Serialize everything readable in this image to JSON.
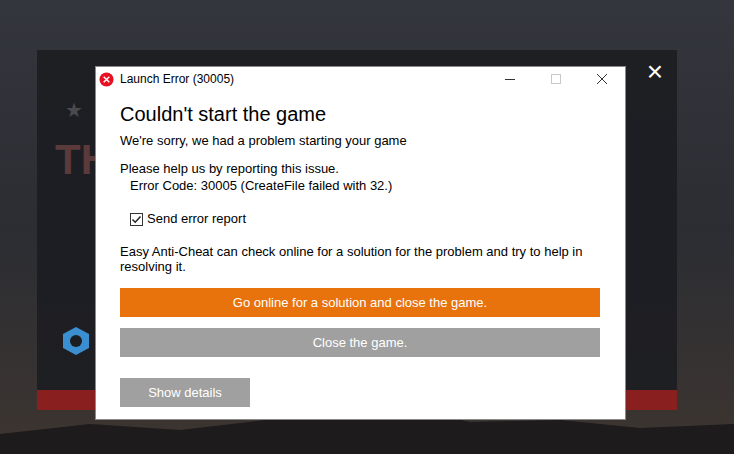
{
  "launcher": {
    "heading": "TH",
    "star": "★",
    "close": "×"
  },
  "dialog": {
    "title": "Launch Error (30005)",
    "heading": "Couldn't start the game",
    "subheading": "We're sorry, we had a problem starting your game",
    "report_prompt": "Please help us by reporting this issue.",
    "error_code": "Error Code: 30005 (CreateFile failed with 32.)",
    "checkbox": {
      "label": "Send error report",
      "checked": true
    },
    "info": "Easy Anti-Cheat can check online for a solution for the problem and try to help in resolving it.",
    "buttons": [
      {
        "label": "Go online for a solution and close the game.",
        "kind": "primary"
      },
      {
        "label": "Close the game.",
        "kind": "secondary"
      }
    ],
    "details_button": "Show details"
  }
}
